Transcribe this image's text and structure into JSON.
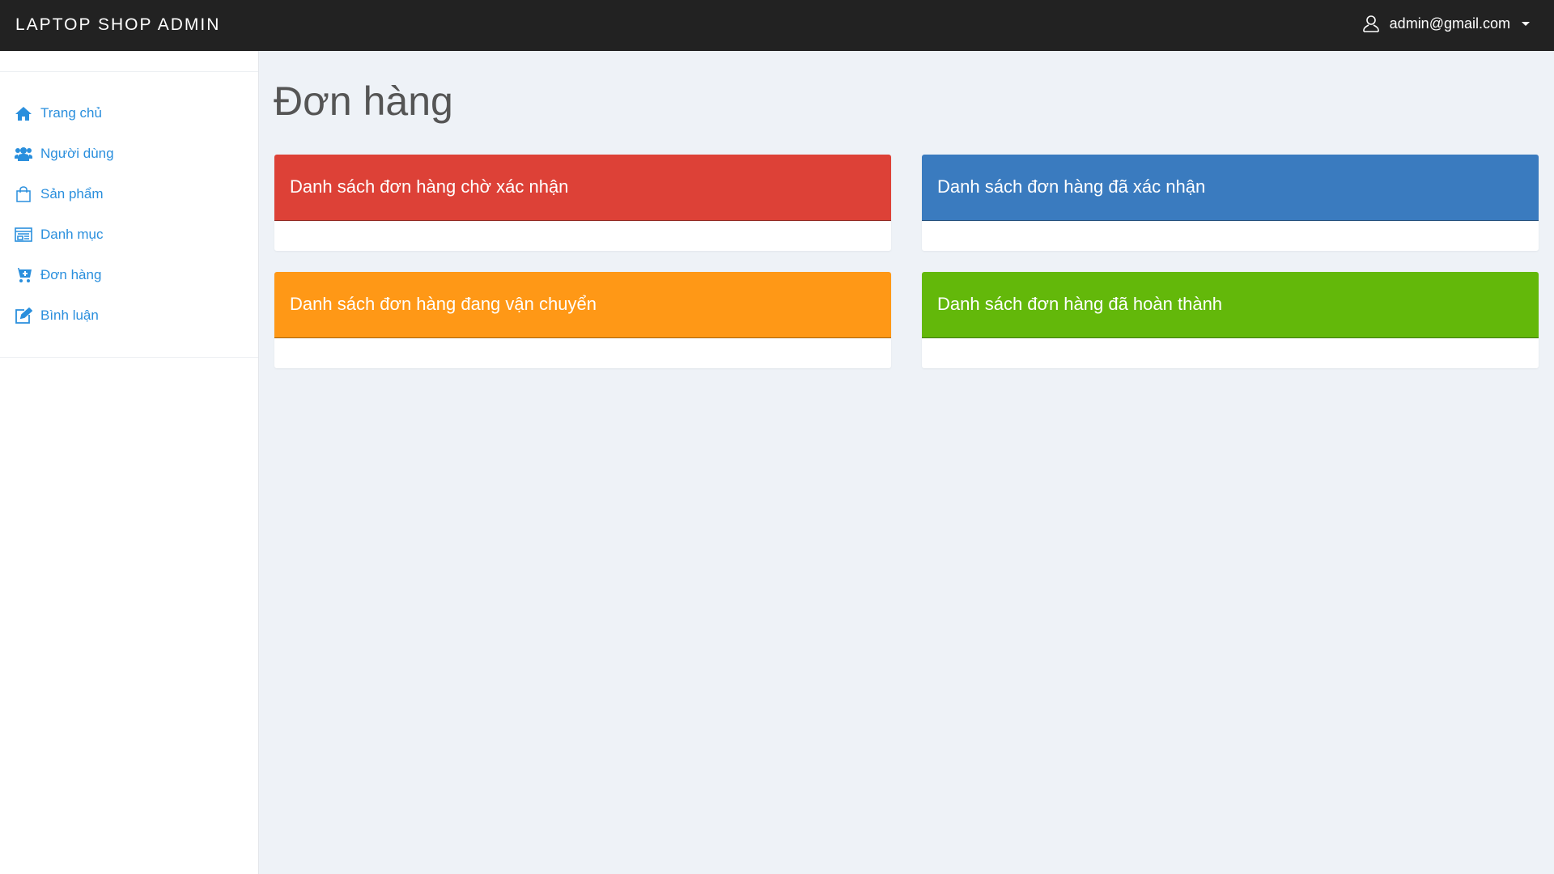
{
  "navbar": {
    "brand": "LAPTOP SHOP ADMIN",
    "user_email": "admin@gmail.com",
    "user_icon": "user-icon"
  },
  "sidebar": {
    "items": [
      {
        "label": "Trang chủ",
        "icon": "home-icon"
      },
      {
        "label": "Người dùng",
        "icon": "users-icon"
      },
      {
        "label": "Sản phẩm",
        "icon": "shopping-bag-icon"
      },
      {
        "label": "Danh mục",
        "icon": "list-icon"
      },
      {
        "label": "Đơn hàng",
        "icon": "cart-plus-icon"
      },
      {
        "label": "Bình luận",
        "icon": "edit-icon"
      }
    ]
  },
  "main": {
    "title": "Đơn hàng",
    "panels": [
      {
        "label": "Danh sách đơn hàng chờ xác nhận",
        "color": "#dd4137"
      },
      {
        "label": "Danh sách đơn hàng đã xác nhận",
        "color": "#3a7bbf"
      },
      {
        "label": "Danh sách đơn hàng đang vận chuyển",
        "color": "#ff9816"
      },
      {
        "label": "Danh sách đơn hàng đã hoàn thành",
        "color": "#63b80a"
      }
    ]
  }
}
